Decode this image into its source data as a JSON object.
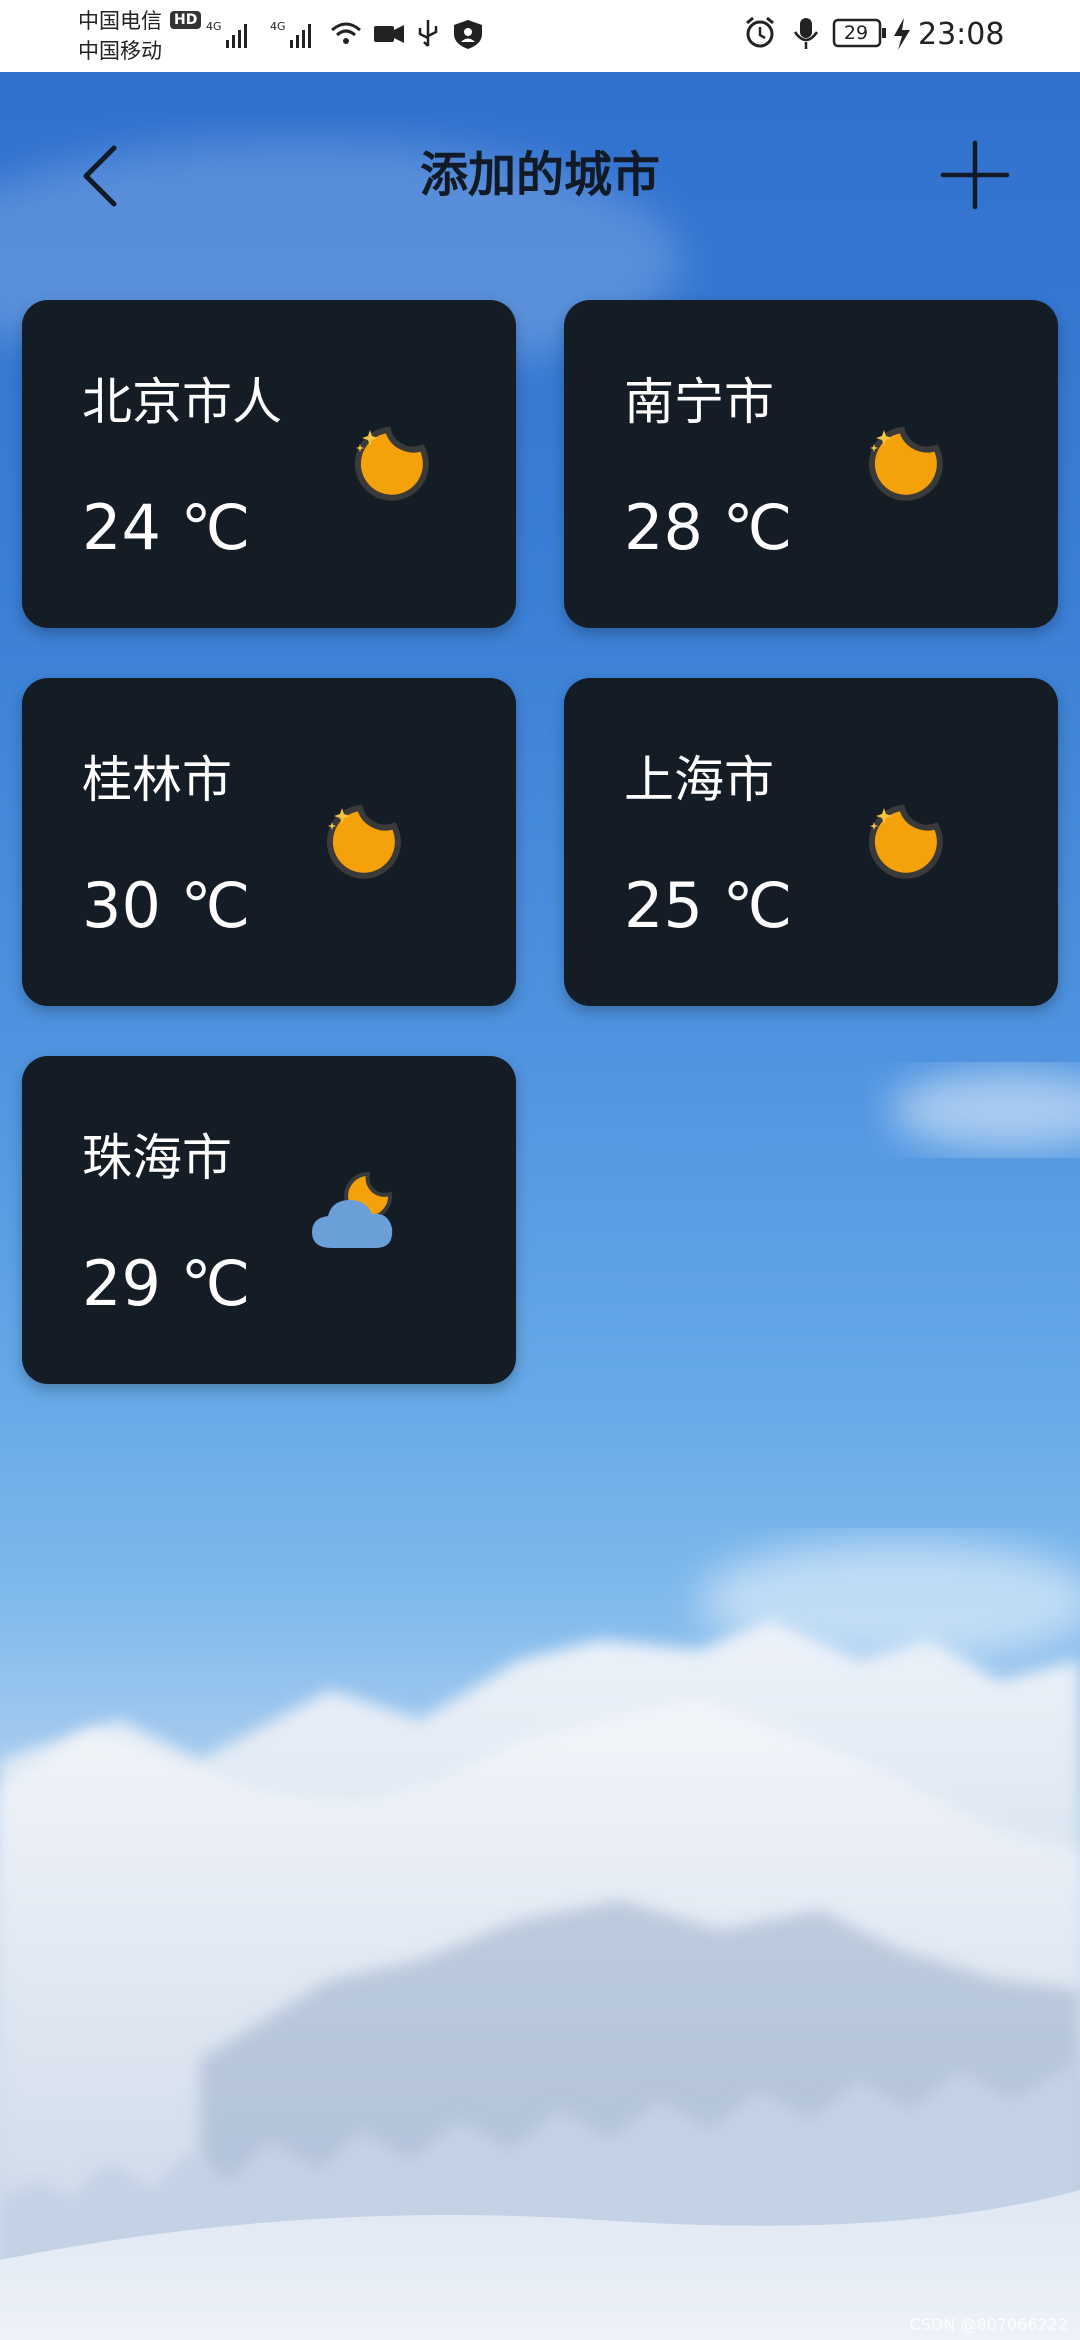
{
  "status_bar": {
    "carrier_1": "中国电信",
    "carrier_2": "中国移动",
    "hd_badge": "HD",
    "battery": "29",
    "time": "23:08"
  },
  "header": {
    "title": "添加的城市"
  },
  "cities": [
    {
      "name": "北京市人",
      "temp": "24 ℃",
      "icon": "moon-stars-icon"
    },
    {
      "name": "南宁市",
      "temp": "28 ℃",
      "icon": "moon-stars-icon"
    },
    {
      "name": "桂林市",
      "temp": "30 ℃",
      "icon": "moon-stars-icon"
    },
    {
      "name": "上海市",
      "temp": "25 ℃",
      "icon": "moon-stars-icon"
    },
    {
      "name": "珠海市",
      "temp": "29 ℃",
      "icon": "cloudy-night-icon"
    }
  ],
  "watermark": "CSDN @807066222",
  "colors": {
    "card_bg": "#141d26",
    "moon": "#f5a20a",
    "cloud": "#6a9fd8"
  }
}
